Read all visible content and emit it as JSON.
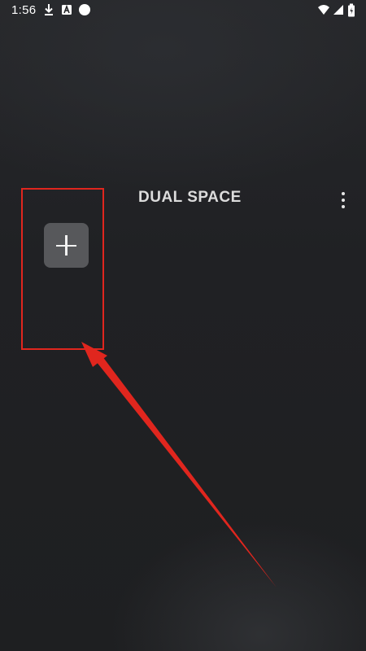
{
  "status_bar": {
    "time": "1:56",
    "left_icons": [
      "download-icon",
      "app-a-icon",
      "circle-dot-icon"
    ],
    "right_icons": [
      "wifi-icon",
      "signal-icon",
      "battery-icon"
    ]
  },
  "header": {
    "logo_text": "DUAL SPACE",
    "menu_icon": "more-vertical-icon"
  },
  "main": {
    "add_button_icon": "plus-icon"
  },
  "annotation": {
    "highlight_color": "#e0261e",
    "arrow_color": "#e0261e"
  },
  "colors": {
    "background": "#1f2022",
    "add_button": "#57585b"
  }
}
